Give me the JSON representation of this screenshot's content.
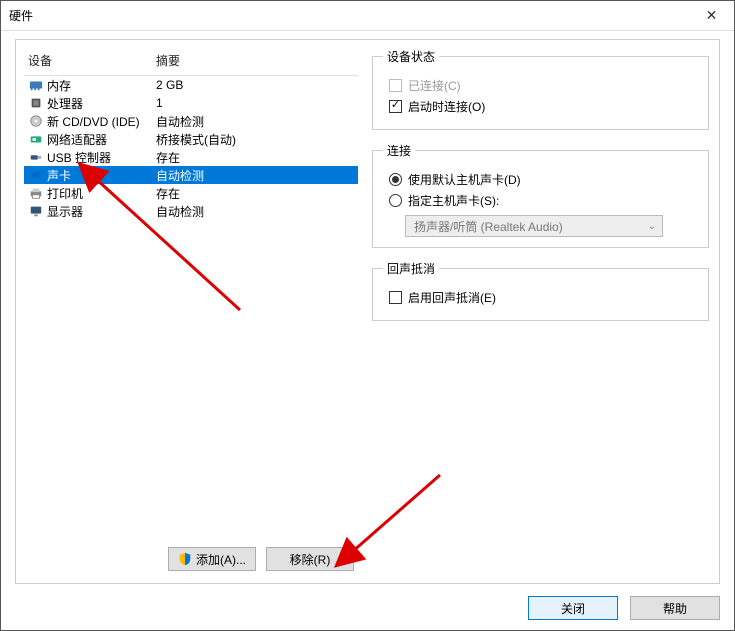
{
  "window": {
    "title": "硬件"
  },
  "list": {
    "header_device": "设备",
    "header_summary": "摘要",
    "rows": [
      {
        "icon": "memory-icon",
        "name": "内存",
        "summary": "2 GB",
        "selected": false
      },
      {
        "icon": "cpu-icon",
        "name": "处理器",
        "summary": "1",
        "selected": false
      },
      {
        "icon": "cd-icon",
        "name": "新 CD/DVD (IDE)",
        "summary": "自动检测",
        "selected": false
      },
      {
        "icon": "nic-icon",
        "name": "网络适配器",
        "summary": "桥接模式(自动)",
        "selected": false
      },
      {
        "icon": "usb-icon",
        "name": "USB 控制器",
        "summary": "存在",
        "selected": false
      },
      {
        "icon": "sound-icon",
        "name": "声卡",
        "summary": "自动检测",
        "selected": true
      },
      {
        "icon": "printer-icon",
        "name": "打印机",
        "summary": "存在",
        "selected": false
      },
      {
        "icon": "display-icon",
        "name": "显示器",
        "summary": "自动检测",
        "selected": false
      }
    ]
  },
  "buttons": {
    "add": "添加(A)...",
    "remove": "移除(R)"
  },
  "status": {
    "legend": "设备状态",
    "connected": "已连接(C)",
    "connect_on_power": "启动时连接(O)"
  },
  "connection": {
    "legend": "连接",
    "use_default": "使用默认主机声卡(D)",
    "specify_host": "指定主机声卡(S):",
    "combo_value": "扬声器/听筒 (Realtek Audio)"
  },
  "echo": {
    "legend": "回声抵消",
    "enable": "启用回声抵消(E)"
  },
  "footer": {
    "close": "关闭",
    "help": "帮助"
  }
}
